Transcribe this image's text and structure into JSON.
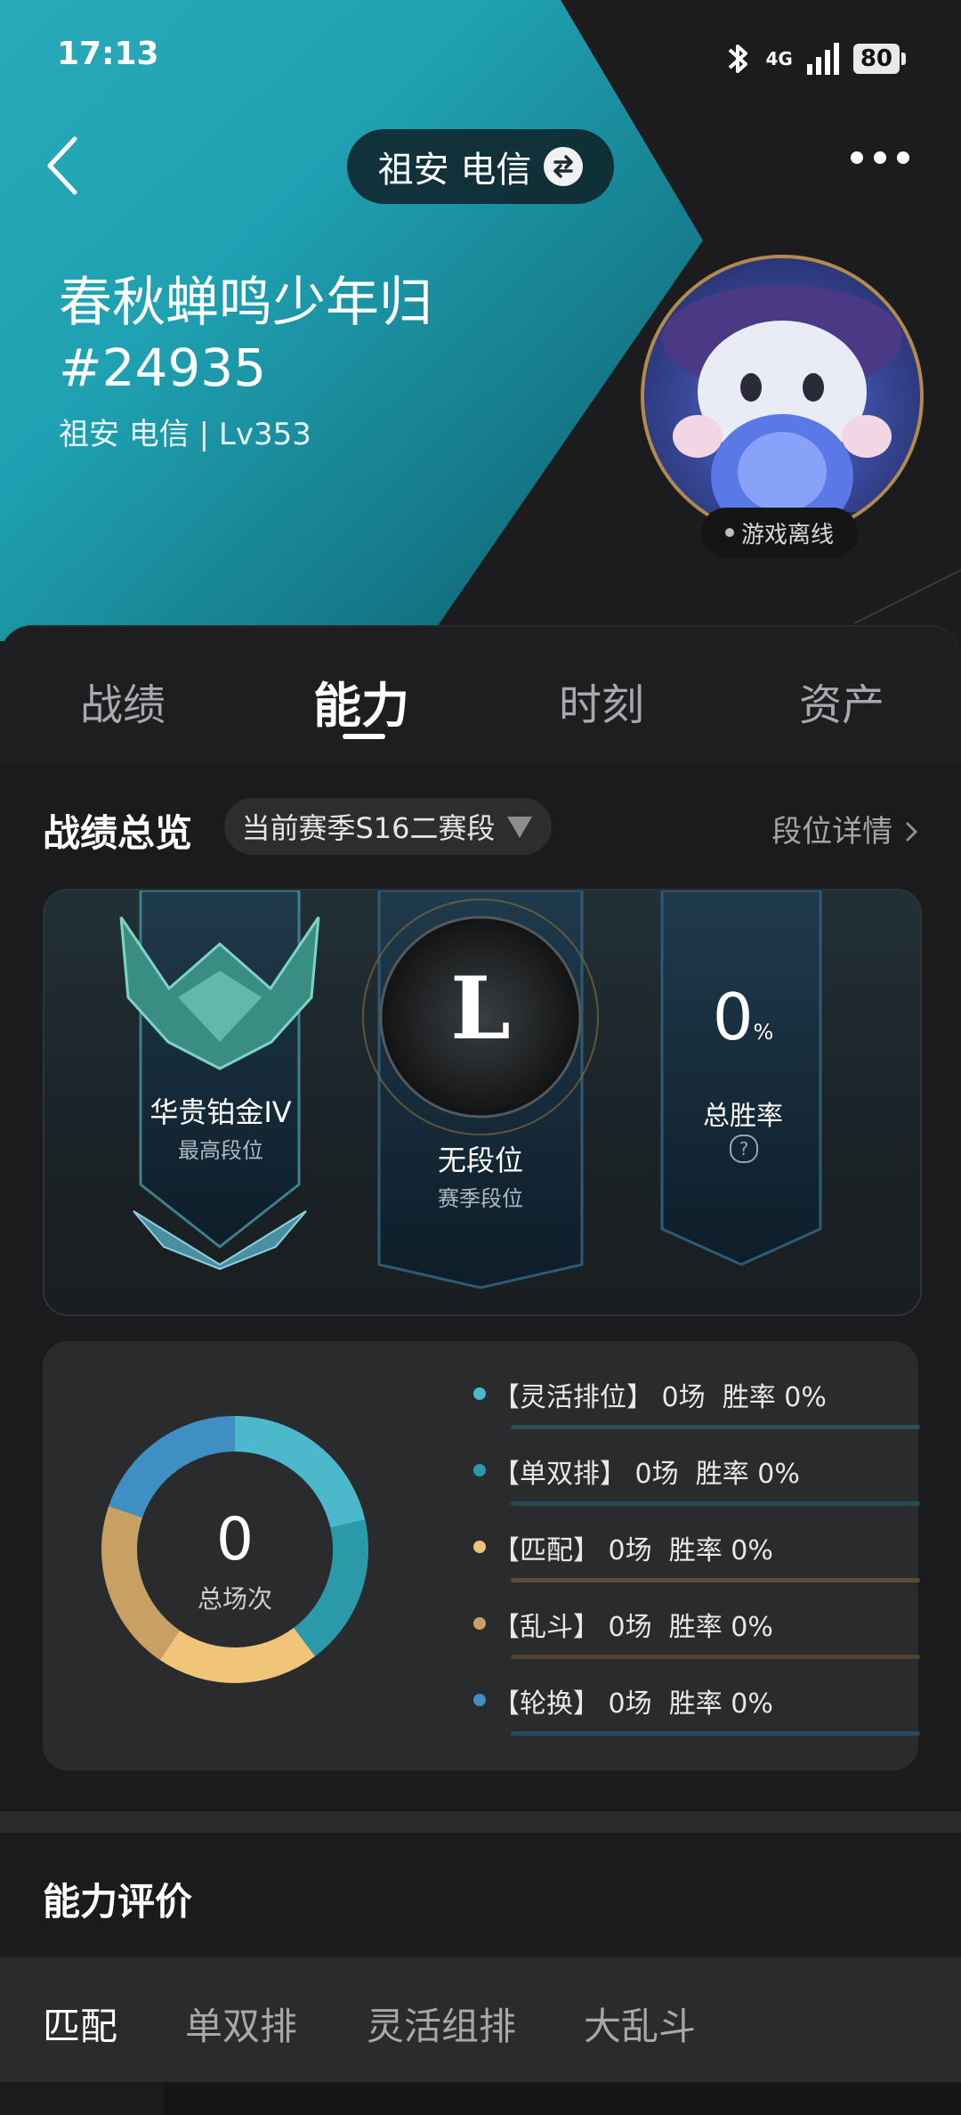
{
  "status_bar": {
    "time": "17:13",
    "network": "4G",
    "battery": "80"
  },
  "header": {
    "server_name": "祖安 电信"
  },
  "profile": {
    "name": "春秋蝉鸣少年归",
    "tag": "#24935",
    "subtitle": "祖安 电信 | Lv353",
    "online_status": "游戏离线"
  },
  "tabs": [
    {
      "label": "战绩"
    },
    {
      "label": "能力"
    },
    {
      "label": "时刻"
    },
    {
      "label": "资产"
    }
  ],
  "overview": {
    "title": "战绩总览",
    "season_selector": "当前赛季S16二赛段",
    "detail_link": "段位详情",
    "highest_rank": {
      "value": "华贵铂金IV",
      "label": "最高段位"
    },
    "season_rank": {
      "value": "无段位",
      "label": "赛季段位",
      "emblem": "L"
    },
    "win_rate": {
      "value": "0",
      "unit": "%",
      "label": "总胜率"
    }
  },
  "modes": {
    "total": "0",
    "total_label": "总场次",
    "items": [
      {
        "name": "【灵活排位】",
        "games": "0场",
        "win_rate": "胜率 0%",
        "color": "#4bb8cb"
      },
      {
        "name": "【单双排】",
        "games": "0场",
        "win_rate": "胜率 0%",
        "color": "#2a9aaa"
      },
      {
        "name": "【匹配】",
        "games": "0场",
        "win_rate": "胜率 0%",
        "color": "#f0c57a"
      },
      {
        "name": "【乱斗】",
        "games": "0场",
        "win_rate": "胜率 0%",
        "color": "#c9a064"
      },
      {
        "name": "【轮换】",
        "games": "0场",
        "win_rate": "胜率 0%",
        "color": "#3f8fc4"
      }
    ]
  },
  "ability": {
    "title": "能力评价",
    "tabs": [
      {
        "label": "匹配"
      },
      {
        "label": "单双排"
      },
      {
        "label": "灵活组排"
      },
      {
        "label": "大乱斗"
      }
    ]
  }
}
